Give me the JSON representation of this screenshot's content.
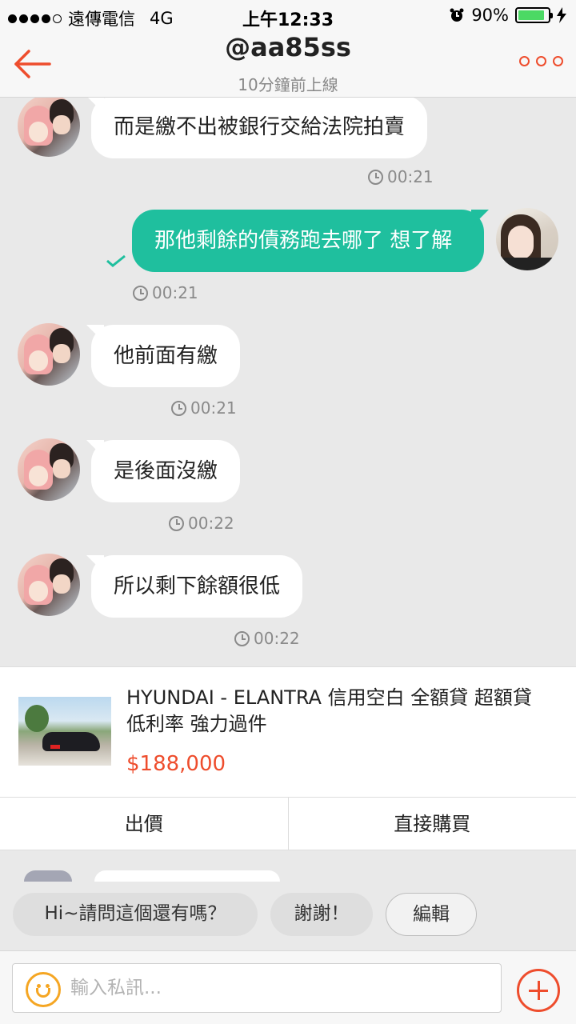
{
  "status_bar": {
    "carrier": "遠傳電信",
    "network": "4G",
    "time": "上午12:33",
    "battery": "90%",
    "battery_level": 0.9
  },
  "header": {
    "title": "@aa85ss",
    "subtitle": "10分鐘前上線"
  },
  "messages": [
    {
      "side": "in",
      "text": "而是繳不出被銀行交給法院拍賣",
      "time": "00:21"
    },
    {
      "side": "out",
      "text": "那他剩餘的債務跑去哪了 想了解",
      "time": "00:21"
    },
    {
      "side": "in",
      "text": "他前面有繳",
      "time": "00:21"
    },
    {
      "side": "in",
      "text": "是後面沒繳",
      "time": "00:22"
    },
    {
      "side": "in",
      "text": "所以剩下餘額很低",
      "time": "00:22"
    }
  ],
  "product": {
    "title": "HYUNDAI - ELANTRA  信用空白 全額貸 超額貸  低利率 強力過件",
    "price": "$188,000",
    "offer_label": "出價",
    "buy_label": "直接購買"
  },
  "quick_replies": [
    "Hi~請問這個還有嗎？",
    "謝謝！",
    "編輯"
  ],
  "input": {
    "placeholder": "輸入私訊..."
  },
  "colors": {
    "accent": "#ee4d2d",
    "outgoing_bubble": "#1fbf9e",
    "background": "#e9e9e9"
  }
}
